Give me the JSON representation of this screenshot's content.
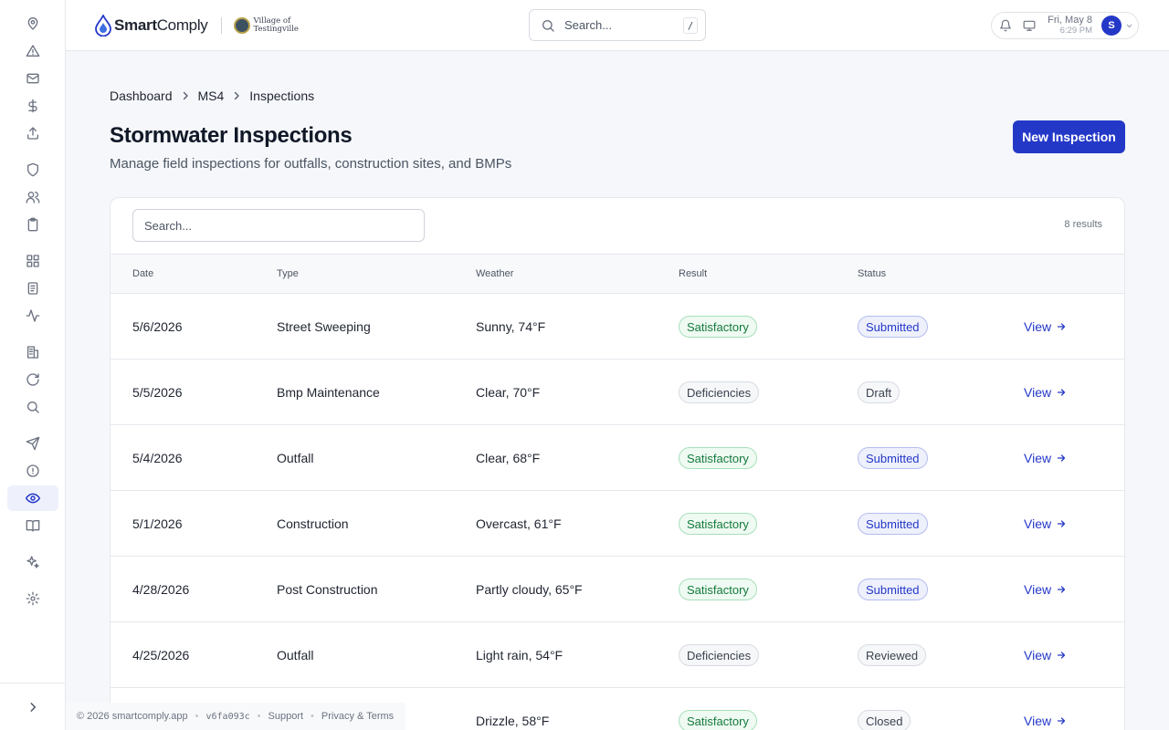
{
  "header": {
    "brand_bold": "Smart",
    "brand_light": "Comply",
    "village_line1": "Village of",
    "village_line2": "Testingville",
    "search_placeholder": "Search...",
    "search_shortcut": "/",
    "date": "Fri, May 8",
    "time": "6:29 PM",
    "avatar_initial": "S"
  },
  "sidebar": {
    "icons": [
      "map-pin-icon",
      "alert-triangle-icon",
      "mail-icon",
      "dollar-icon",
      "upload-icon",
      "shield-icon",
      "users-icon",
      "clipboard-icon",
      "grid-icon",
      "document-icon",
      "activity-icon",
      "building-icon",
      "refresh-icon",
      "search-icon",
      "send-icon",
      "alert-circle-icon",
      "eye-icon",
      "book-icon",
      "sparkles-icon",
      "settings-icon"
    ],
    "active": "eye-icon",
    "expand_icon": "chevron-right-icon"
  },
  "breadcrumb": [
    "Dashboard",
    "MS4",
    "Inspections"
  ],
  "page": {
    "title": "Stormwater Inspections",
    "subtitle": "Manage field inspections for outfalls, construction sites, and BMPs",
    "new_button": "New Inspection"
  },
  "table": {
    "search_placeholder": "Search...",
    "results_label": "8 results",
    "columns": [
      "Date",
      "Type",
      "Weather",
      "Result",
      "Status"
    ],
    "view_label": "View",
    "rows": [
      {
        "date": "5/6/2026",
        "type": "Street Sweeping",
        "weather": "Sunny, 74°F",
        "result": "Satisfactory",
        "status": "Submitted"
      },
      {
        "date": "5/5/2026",
        "type": "Bmp Maintenance",
        "weather": "Clear, 70°F",
        "result": "Deficiencies",
        "status": "Draft"
      },
      {
        "date": "5/4/2026",
        "type": "Outfall",
        "weather": "Clear, 68°F",
        "result": "Satisfactory",
        "status": "Submitted"
      },
      {
        "date": "5/1/2026",
        "type": "Construction",
        "weather": "Overcast, 61°F",
        "result": "Satisfactory",
        "status": "Submitted"
      },
      {
        "date": "4/28/2026",
        "type": "Post Construction",
        "weather": "Partly cloudy, 65°F",
        "result": "Satisfactory",
        "status": "Submitted"
      },
      {
        "date": "4/25/2026",
        "type": "Outfall",
        "weather": "Light rain, 54°F",
        "result": "Deficiencies",
        "status": "Reviewed"
      },
      {
        "date": "",
        "type": "",
        "weather": "Drizzle, 58°F",
        "result": "Satisfactory",
        "status": "Closed"
      }
    ]
  },
  "footer": {
    "copyright": "© 2026 smartcomply.app",
    "version": "v6fa093c",
    "support": "Support",
    "privacy": "Privacy & Terms"
  },
  "colors": {
    "accent": "#2438c8",
    "satisfactory": "#157a3c",
    "submitted": "#2438c8"
  }
}
